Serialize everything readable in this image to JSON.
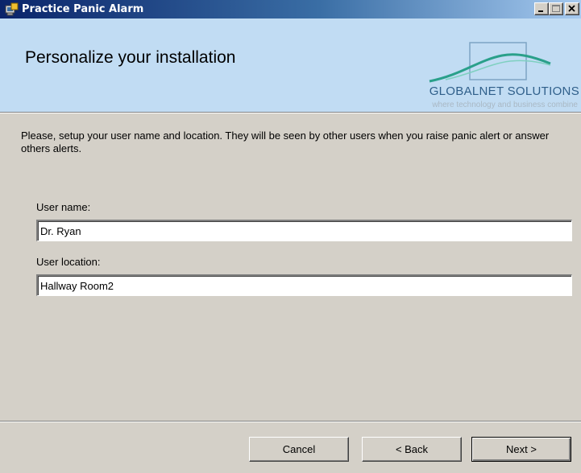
{
  "window": {
    "title": "Practice Panic Alarm",
    "title_icon": "installer-icon",
    "controls": [
      "minimize-icon",
      "maximize-icon",
      "close-icon"
    ]
  },
  "header": {
    "title": "Personalize your installation",
    "logo": {
      "name": "GLOBALNET SOLUTIONS",
      "tagline": "where technology and business combine"
    }
  },
  "main": {
    "intro": "Please, setup your user name and location. They will be seen by other users when you raise panic alert or answer others alerts.",
    "fields": {
      "user_name": {
        "label": "User name:",
        "value": "Dr. Ryan"
      },
      "user_location": {
        "label": "User location:",
        "value": "Hallway Room2"
      }
    }
  },
  "footer": {
    "cancel_label": "Cancel",
    "back_label": "< Back",
    "next_label": "Next >"
  },
  "colors": {
    "title_bar": "#0a246a",
    "banner": "#c1dcf3",
    "dialog": "#d4d0c8",
    "logo_text": "#2f5f8a"
  }
}
